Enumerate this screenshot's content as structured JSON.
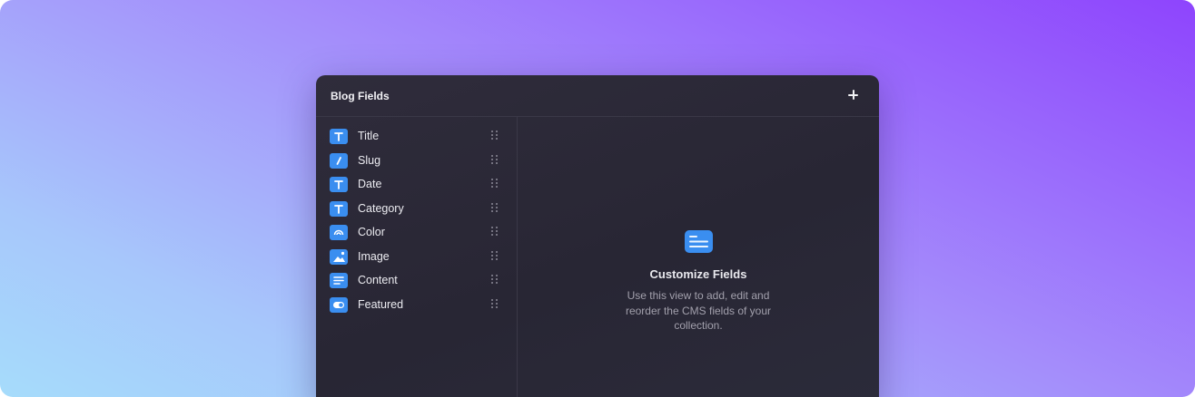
{
  "panel": {
    "title": "Blog Fields",
    "add_icon": "plus-icon"
  },
  "fields": [
    {
      "label": "Title",
      "icon": "text-icon"
    },
    {
      "label": "Slug",
      "icon": "slash-icon"
    },
    {
      "label": "Date",
      "icon": "text-icon"
    },
    {
      "label": "Category",
      "icon": "text-icon"
    },
    {
      "label": "Color",
      "icon": "color-icon"
    },
    {
      "label": "Image",
      "icon": "image-icon"
    },
    {
      "label": "Content",
      "icon": "rich-text-icon"
    },
    {
      "label": "Featured",
      "icon": "toggle-icon"
    }
  ],
  "empty_state": {
    "icon": "collection-icon",
    "title": "Customize Fields",
    "description": "Use this view to add, edit and reorder the CMS fields of your collection."
  },
  "colors": {
    "accent": "#3a8ef0",
    "panel_bg": "#2b2938",
    "gradient_start": "#8e44fd",
    "gradient_end": "#a6dcfb"
  }
}
